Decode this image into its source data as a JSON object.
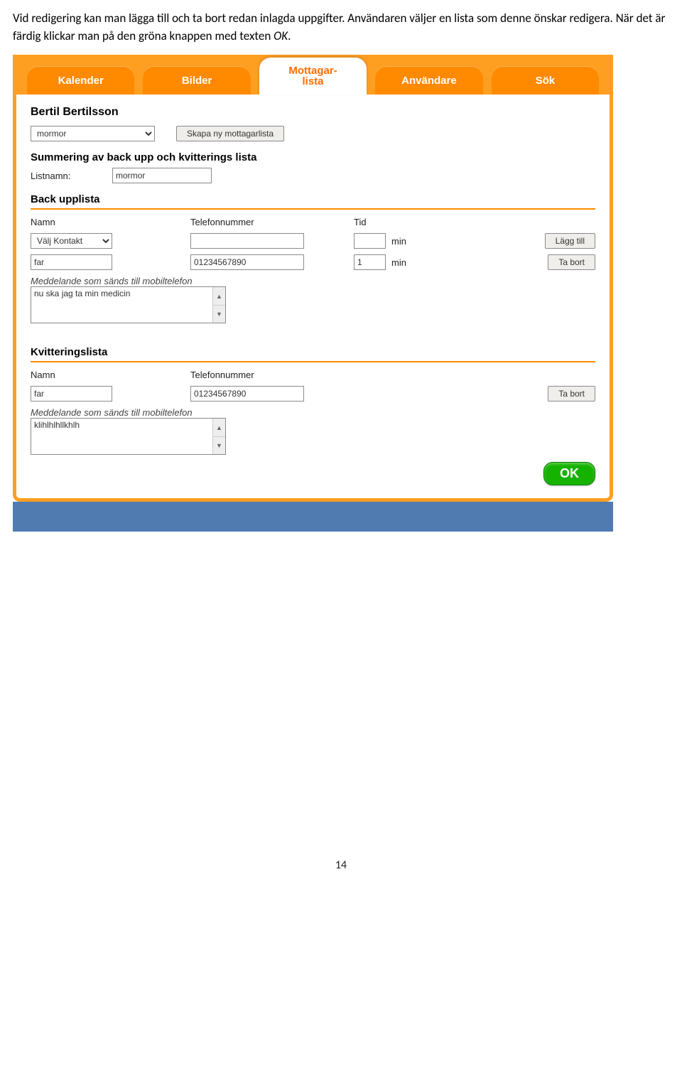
{
  "page": {
    "intro_pre": "Vid redigering kan man lägga till och ta bort redan inlagda uppgifter. Användaren väljer en lista som denne önskar redigera. När det är färdig klickar man på den gröna knappen med texten ",
    "intro_em": "OK",
    "intro_post": ".",
    "number": "14"
  },
  "tabs": {
    "kalender": "Kalender",
    "bilder": "Bilder",
    "mottagar_l1": "Mottagar-",
    "mottagar_l2": "lista",
    "anvandare": "Användare",
    "sok": "Sök"
  },
  "user": {
    "name": "Bertil Bertilsson"
  },
  "topControls": {
    "listSelect": "mormor",
    "createNew": "Skapa ny mottagarlista"
  },
  "summary": {
    "title": "Summering av back upp och kvitterings lista",
    "listNameLabel": "Listnamn:",
    "listNameValue": "mormor"
  },
  "backup": {
    "title": "Back upplista",
    "cols": {
      "name": "Namn",
      "tel": "Telefonnummer",
      "tid": "Tid"
    },
    "row1": {
      "select": "Välj Kontakt",
      "tel": "",
      "tid": "",
      "min": "min",
      "action": "Lägg till"
    },
    "row2": {
      "name": "far",
      "tel": "01234567890",
      "tid": "1",
      "min": "min",
      "action": "Ta bort"
    },
    "msgLabel": "Meddelande som sänds till mobiltelefon",
    "msgValue": "nu ska jag ta min medicin"
  },
  "kvitt": {
    "title": "Kvitteringslista",
    "cols": {
      "name": "Namn",
      "tel": "Telefonnummer"
    },
    "row1": {
      "name": "far",
      "tel": "01234567890",
      "action": "Ta bort"
    },
    "msgLabel": "Meddelande som sänds till mobiltelefon",
    "msgValue": "klihlhlhllkhlh"
  },
  "ok": "OK"
}
